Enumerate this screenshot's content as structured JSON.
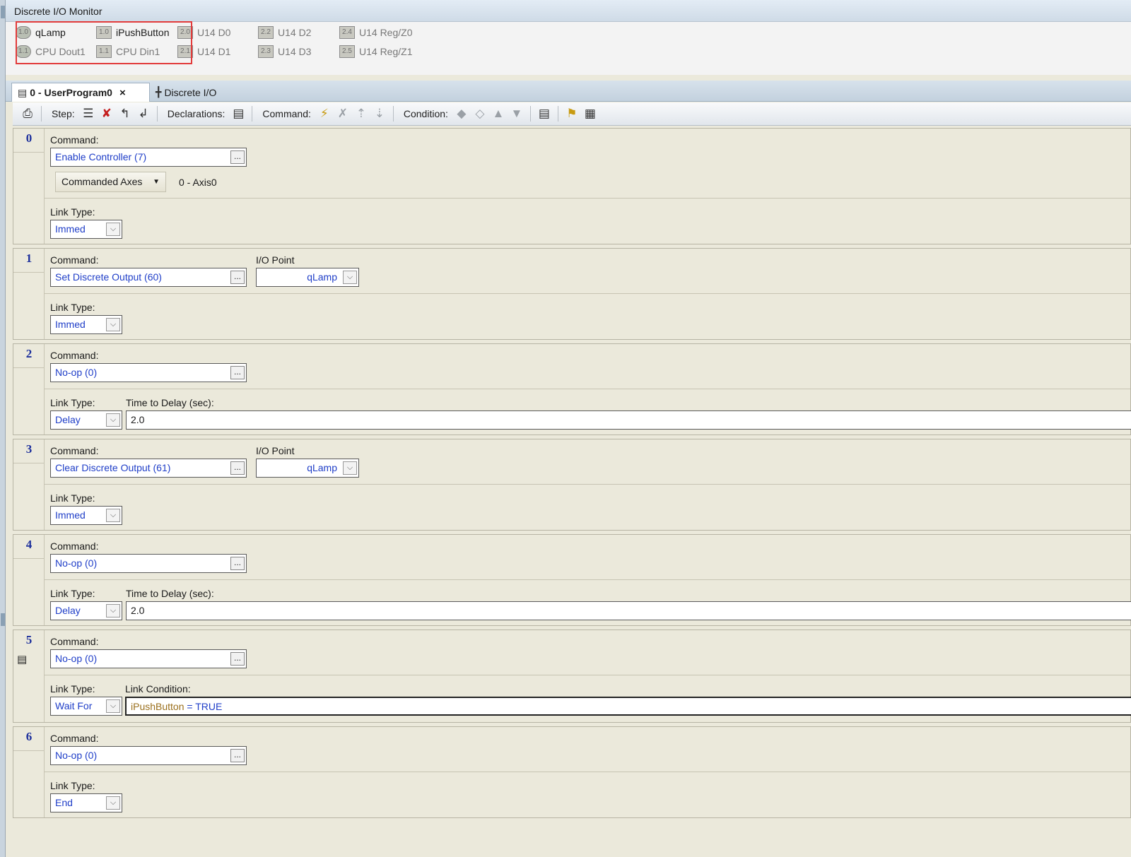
{
  "monitor": {
    "title": "Discrete I/O Monitor",
    "points": [
      {
        "tag": "1.0",
        "label": "qLamp",
        "style": "round"
      },
      {
        "tag": "1.1",
        "label": "CPU Dout1",
        "style": "round"
      },
      {
        "tag": "1.0",
        "label": "iPushButton",
        "style": "square"
      },
      {
        "tag": "1.1",
        "label": "CPU Din1",
        "style": "square"
      },
      {
        "tag": "2.0",
        "label": "U14 D0",
        "style": "square"
      },
      {
        "tag": "2.1",
        "label": "U14 D1",
        "style": "square"
      },
      {
        "tag": "2.2",
        "label": "U14 D2",
        "style": "square"
      },
      {
        "tag": "2.3",
        "label": "U14 D3",
        "style": "square"
      },
      {
        "tag": "2.4",
        "label": "U14 Reg/Z0",
        "style": "square"
      },
      {
        "tag": "2.5",
        "label": "U14 Reg/Z1",
        "style": "square"
      }
    ]
  },
  "tabs": [
    {
      "label": "0 - UserProgram0",
      "close": "×",
      "icon": "program-icon",
      "active": true
    },
    {
      "label": "Discrete I/O",
      "icon": "network-icon",
      "active": false
    }
  ],
  "toolbar": {
    "step_label": "Step:",
    "declarations_label": "Declarations:",
    "command_label": "Command:",
    "condition_label": "Condition:"
  },
  "labels": {
    "command": "Command:",
    "link_type": "Link Type:",
    "io_point": "I/O Point",
    "time_to_delay": "Time to Delay (sec):",
    "link_condition": "Link Condition:",
    "ellipsis": "...",
    "dropdown": "⌵"
  },
  "steps": [
    {
      "number": "0",
      "command": "Enable Controller (7)",
      "axes_button": "Commanded Axes",
      "axes_value": "0 - Axis0",
      "link_type": "Immed"
    },
    {
      "number": "1",
      "command": "Set Discrete Output (60)",
      "io_point": "qLamp",
      "link_type": "Immed"
    },
    {
      "number": "2",
      "command": "No-op (0)",
      "link_type": "Delay",
      "delay": "2.0"
    },
    {
      "number": "3",
      "command": "Clear Discrete Output (61)",
      "io_point": "qLamp",
      "link_type": "Immed"
    },
    {
      "number": "4",
      "command": "No-op (0)",
      "link_type": "Delay",
      "delay": "2.0"
    },
    {
      "number": "5",
      "command": "No-op (0)",
      "link_type": "Wait For",
      "condition_var": "iPushButton",
      "condition_rest": " = TRUE",
      "has_note": true
    },
    {
      "number": "6",
      "command": "No-op (0)",
      "link_type": "End"
    }
  ]
}
